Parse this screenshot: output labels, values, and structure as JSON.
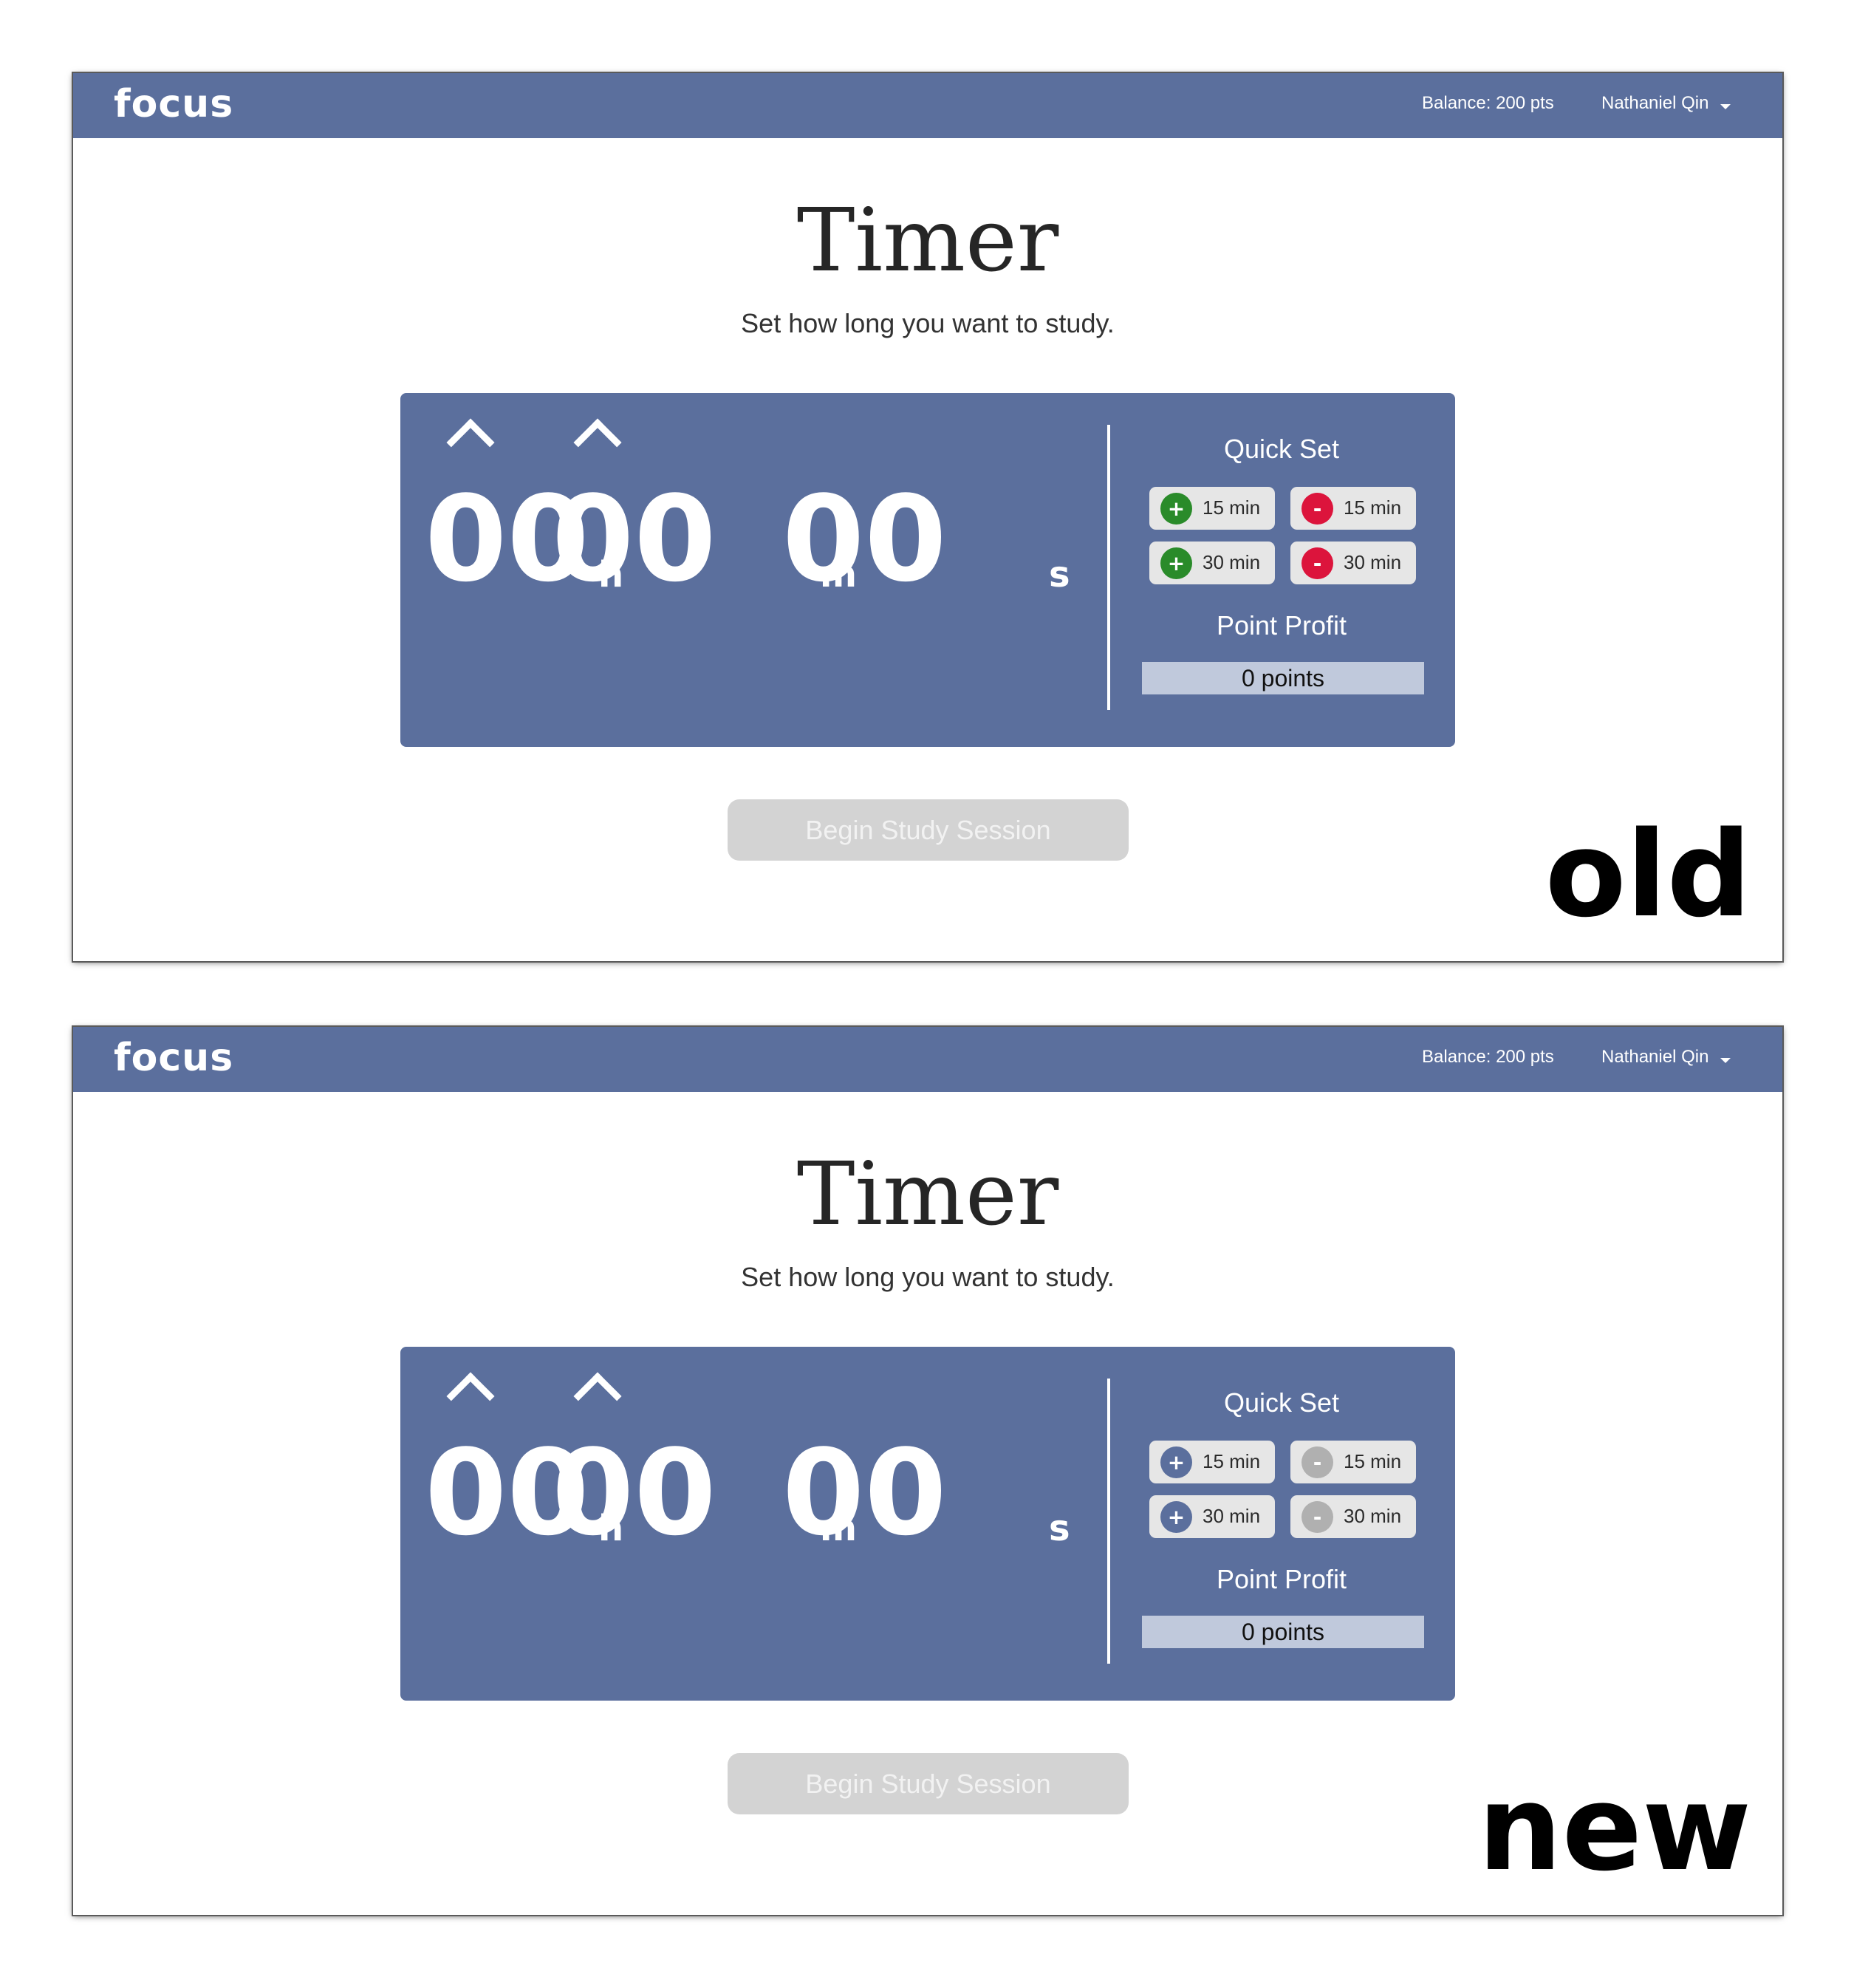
{
  "colors": {
    "nav_bg": "#5b6f9d",
    "timer_bg": "#5b6f9d",
    "old_plus": "#2a8b2a",
    "old_minus": "#dc143c",
    "new_plus": "#5b6f9d",
    "new_minus": "#b0b0b0"
  },
  "panels": [
    {
      "nav": {
        "logo": "focus",
        "balance": "Balance: 200 pts",
        "user": "Nathaniel Qin"
      },
      "title": "Timer",
      "subtitle": "Set how long you want to study.",
      "timer": {
        "hours": "00",
        "hours_unit": "h",
        "minutes": "00",
        "minutes_unit": "m",
        "seconds": "00",
        "seconds_unit": "s"
      },
      "quick_set": {
        "heading": "Quick Set",
        "buttons": [
          {
            "symbol": "+",
            "label": "15 min"
          },
          {
            "symbol": "-",
            "label": "15 min"
          },
          {
            "symbol": "+",
            "label": "30 min"
          },
          {
            "symbol": "-",
            "label": "30 min"
          }
        ]
      },
      "point_profit": {
        "heading": "Point Profit",
        "value": "0 points"
      },
      "begin_button": "Begin Study Session",
      "version_label": "old"
    },
    {
      "nav": {
        "logo": "focus",
        "balance": "Balance: 200 pts",
        "user": "Nathaniel Qin"
      },
      "title": "Timer",
      "subtitle": "Set how long you want to study.",
      "timer": {
        "hours": "00",
        "hours_unit": "h",
        "minutes": "00",
        "minutes_unit": "m",
        "seconds": "00",
        "seconds_unit": "s"
      },
      "quick_set": {
        "heading": "Quick Set",
        "buttons": [
          {
            "symbol": "+",
            "label": "15 min"
          },
          {
            "symbol": "-",
            "label": "15 min"
          },
          {
            "symbol": "+",
            "label": "30 min"
          },
          {
            "symbol": "-",
            "label": "30 min"
          }
        ]
      },
      "point_profit": {
        "heading": "Point Profit",
        "value": "0 points"
      },
      "begin_button": "Begin Study Session",
      "version_label": "new"
    }
  ]
}
